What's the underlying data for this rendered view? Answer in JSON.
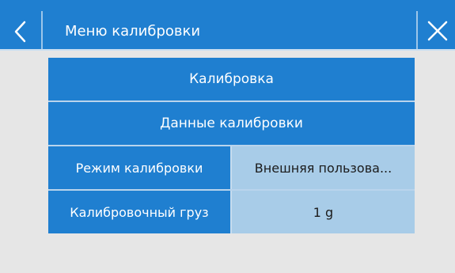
{
  "header": {
    "title": "Меню калибровки",
    "back_icon": "chevron-left-icon",
    "close_icon": "close-icon"
  },
  "menu": [
    {
      "label": "Калибровка"
    },
    {
      "label": "Данные калибровки"
    }
  ],
  "settings": [
    {
      "label": "Режим калибровки",
      "value": "Внешняя пользова..."
    },
    {
      "label": "Калибровочный груз",
      "value": "1 g"
    }
  ],
  "colors": {
    "accent": "#1f7fd0",
    "value_bg": "#a8cce8",
    "background": "#e6e6e6"
  }
}
